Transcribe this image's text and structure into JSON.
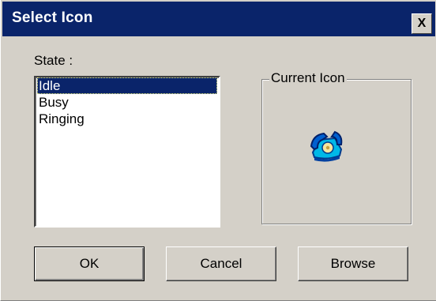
{
  "window": {
    "title": "Select Icon",
    "close_label": "X"
  },
  "state_label": "State :",
  "states": [
    {
      "label": "Idle",
      "selected": true
    },
    {
      "label": "Busy",
      "selected": false
    },
    {
      "label": "Ringing",
      "selected": false
    }
  ],
  "current_icon": {
    "group_label": "Current Icon",
    "icon": "telephone-icon"
  },
  "buttons": {
    "ok": "OK",
    "cancel": "Cancel",
    "browse": "Browse"
  },
  "colors": {
    "titlebar": "#0a246a",
    "face": "#d4d0c8",
    "selection": "#0a246a"
  }
}
